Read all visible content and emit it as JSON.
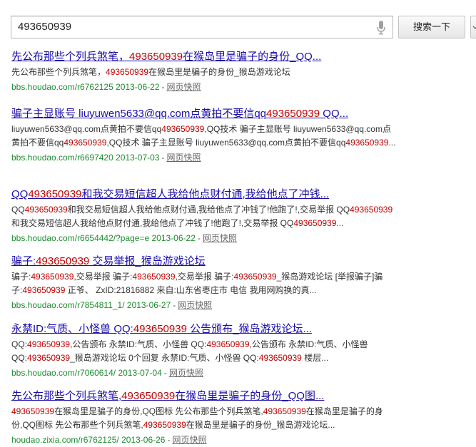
{
  "search": {
    "query": "493650939",
    "button_label": "搜索一下"
  },
  "results": [
    {
      "title": [
        {
          "t": "先公布那些个列兵煞笔，",
          "h": false
        },
        {
          "t": "493650939",
          "h": true
        },
        {
          "t": "在猴岛里是骗子的身份_QQ...",
          "h": false
        }
      ],
      "snippet": [
        {
          "t": "先公布那些个列兵煞笔，",
          "h": false
        },
        {
          "t": "493650939",
          "h": true
        },
        {
          "t": "在猴岛里是骗子的身份_猴岛游戏论坛",
          "h": false
        }
      ],
      "url": "bbs.houdao.com/r6762125 2013-06-22",
      "cache": "网页快照"
    },
    {
      "title": [
        {
          "t": "骗子主显账号 liuyuwen5633@qq.com点黄拍不要信qq",
          "h": false
        },
        {
          "t": "493650939",
          "h": true
        },
        {
          "t": " QQ...",
          "h": false
        }
      ],
      "snippet": [
        {
          "t": "liuyuwen5633@qq.com点黄拍不要信qq",
          "h": false
        },
        {
          "t": "493650939",
          "h": true
        },
        {
          "t": ",QQ技术 骗子主显账号 liuyuwen5633@qq.com点黄拍不要信qq",
          "h": false
        },
        {
          "t": "493650939",
          "h": true
        },
        {
          "t": ",QQ技术 骗子主显账号 liuyuwen5633@qq.com点黄拍不要信qq",
          "h": false
        },
        {
          "t": "493650939",
          "h": true
        },
        {
          "t": "...",
          "h": false
        }
      ],
      "url": "bbs.houdao.com/r6697420 2013-07-03",
      "cache": "网页快照"
    },
    {
      "title": [
        {
          "t": "QQ",
          "h": false
        },
        {
          "t": "493650939",
          "h": true
        },
        {
          "t": "和我交易短信超人我给他点财付通,我给他点了冲钱...",
          "h": false
        }
      ],
      "snippet": [
        {
          "t": "QQ",
          "h": false
        },
        {
          "t": "493650939",
          "h": true
        },
        {
          "t": "和我交易短信超人我给他点财付通,我给他点了冲钱了!他跑了!,交易举报 QQ",
          "h": false
        },
        {
          "t": "493650939",
          "h": true
        },
        {
          "t": "和我交易短信超人我给他点财付通,我给他点了冲钱了!他跑了!,交易举报 QQ",
          "h": false
        },
        {
          "t": "493650939",
          "h": true
        },
        {
          "t": "...",
          "h": false
        }
      ],
      "url": "bbs.houdao.com/r6654442/?page=e 2013-06-22",
      "cache": "网页快照"
    },
    {
      "title": [
        {
          "t": "骗子:",
          "h": false
        },
        {
          "t": "493650939",
          "h": true
        },
        {
          "t": " 交易举报_猴岛游戏论坛",
          "h": false
        }
      ],
      "snippet": [
        {
          "t": "骗子:",
          "h": false
        },
        {
          "t": "493650939",
          "h": true
        },
        {
          "t": ",交易举报 骗子:",
          "h": false
        },
        {
          "t": "493650939",
          "h": true
        },
        {
          "t": ",交易举报 骗子:",
          "h": false
        },
        {
          "t": "493650939",
          "h": true
        },
        {
          "t": "_猴岛游戏论坛 [举报骗子]骗子:",
          "h": false
        },
        {
          "t": "493650939",
          "h": true
        },
        {
          "t": " 正爷、 ZxID:21816882 来自:山东省枣庄市 电信 我用网购换的真...",
          "h": false
        }
      ],
      "url": "bbs.houdao.com/r7854811_1/ 2013-06-27",
      "cache": "网页快照"
    },
    {
      "title": [
        {
          "t": "永禁ID:气质、小怪兽 QQ:",
          "h": false
        },
        {
          "t": "493650939",
          "h": true
        },
        {
          "t": " 公告颁布_猴岛游戏论坛...",
          "h": false
        }
      ],
      "snippet": [
        {
          "t": "QQ:",
          "h": false
        },
        {
          "t": "493650939",
          "h": true
        },
        {
          "t": ",公告颁布 永禁ID:气质、小怪兽 QQ:",
          "h": false
        },
        {
          "t": "493650939",
          "h": true
        },
        {
          "t": ",公告颁布 永禁ID:气质、小怪兽 QQ:",
          "h": false
        },
        {
          "t": "493650939",
          "h": true
        },
        {
          "t": "_猴岛游戏论坛 0个回复 永禁ID:气质、小怪兽 QQ:",
          "h": false
        },
        {
          "t": "493650939",
          "h": true
        },
        {
          "t": " 楼层...",
          "h": false
        }
      ],
      "url": "bbs.houdao.com/r7060614/ 2013-07-04",
      "cache": "网页快照"
    },
    {
      "title": [
        {
          "t": "先公布那些个列兵煞笔,",
          "h": false
        },
        {
          "t": "493650939",
          "h": true
        },
        {
          "t": "在猴岛里是骗子的身份_QQ图...",
          "h": false
        }
      ],
      "snippet": [
        {
          "t": "493650939",
          "h": true
        },
        {
          "t": "在猴岛里是骗子的身份,QQ图标 先公布那些个列兵煞笔,",
          "h": false
        },
        {
          "t": "493650939",
          "h": true
        },
        {
          "t": "在猴岛里是骗子的身份,QQ图标 先公布那些个列兵煞笔,",
          "h": false
        },
        {
          "t": "493650939",
          "h": true
        },
        {
          "t": "在猴岛里是骗子的身份_猴岛游戏论坛...",
          "h": false
        }
      ],
      "url": "houdao.zixia.com/r6762125/ 2013-06-26",
      "cache": "网页快照"
    }
  ]
}
